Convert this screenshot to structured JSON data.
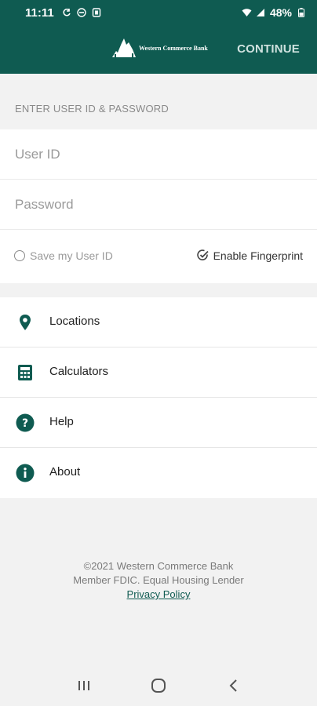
{
  "status_bar": {
    "time": "11:11",
    "battery": "48%",
    "icons": [
      "sync-icon",
      "do-not-disturb-icon",
      "notification-icon",
      "wifi-icon",
      "signal-icon",
      "battery-icon"
    ]
  },
  "header": {
    "logo_text": "Western Commerce Bank",
    "continue_label": "CONTINUE"
  },
  "login": {
    "section_label": "ENTER USER ID & PASSWORD",
    "user_id_placeholder": "User ID",
    "password_placeholder": "Password",
    "save_user_id_label": "Save my User ID",
    "enable_fingerprint_label": "Enable Fingerprint"
  },
  "menu": {
    "items": [
      {
        "label": "Locations",
        "icon": "location-pin-icon"
      },
      {
        "label": "Calculators",
        "icon": "calculator-icon"
      },
      {
        "label": "Help",
        "icon": "help-icon"
      },
      {
        "label": "About",
        "icon": "info-icon"
      }
    ]
  },
  "footer": {
    "copyright": "©2021 Western Commerce Bank",
    "member_line": "Member FDIC. Equal Housing Lender",
    "privacy_link": "Privacy Policy"
  },
  "colors": {
    "brand": "#0f5b51",
    "background": "#f2f2f2"
  }
}
